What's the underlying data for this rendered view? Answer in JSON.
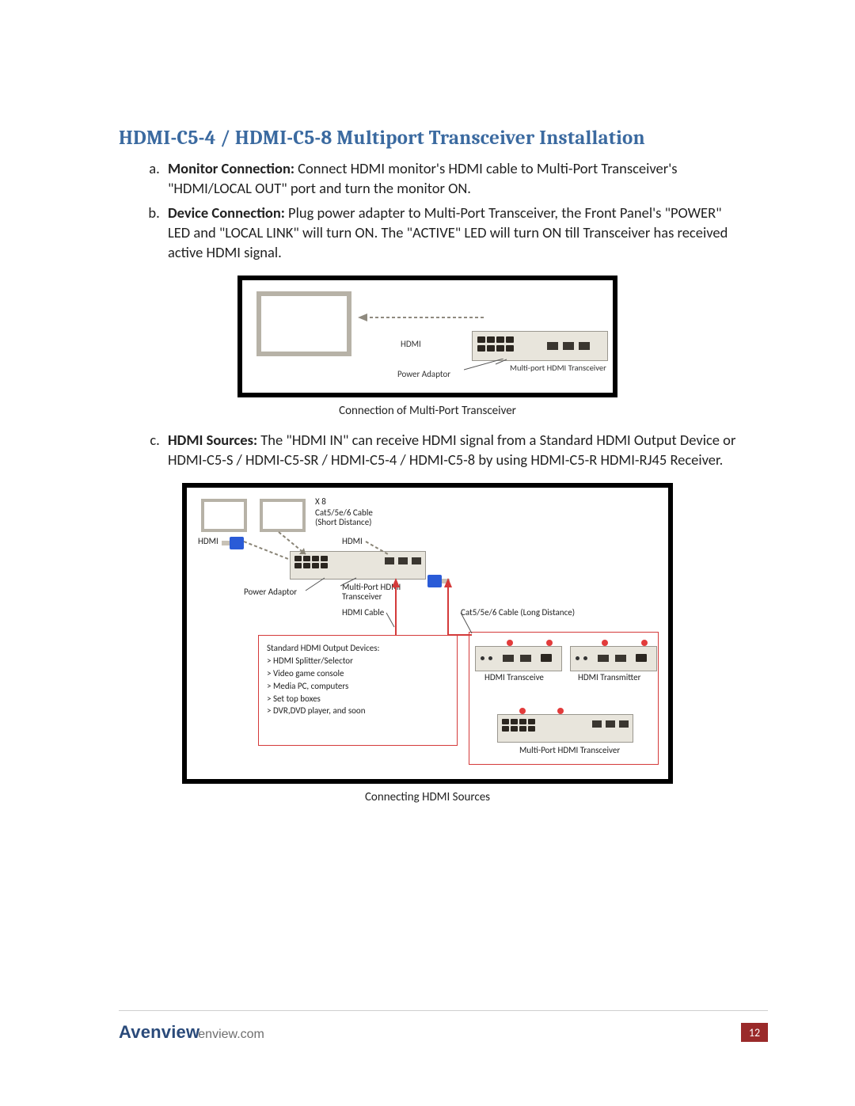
{
  "heading": "HDMI-C5-4 / HDMI-C5-8 Multiport Transceiver Installation",
  "items": {
    "a": {
      "label": "Monitor Connection:",
      "text": " Connect HDMI monitor's HDMI cable to Multi-Port Transceiver's \"HDMI/LOCAL OUT\" port and turn the monitor ON."
    },
    "b": {
      "label": "Device Connection:",
      "text": " Plug power adapter to Multi-Port Transceiver, the Front Panel's \"POWER\" LED and \"LOCAL LINK\" will turn ON. The \"ACTIVE\" LED will turn ON till Transceiver has received active HDMI signal."
    },
    "c": {
      "label": "HDMI Sources:",
      "text": " The \"HDMI IN\" can receive HDMI signal from a Standard HDMI Output Device or HDMI-C5-S / HDMI-C5-SR / HDMI-C5-4 / HDMI-C5-8 by using HDMI-C5-R HDMI-RJ45 Receiver."
    }
  },
  "fig1": {
    "hdmi": "HDMI",
    "power_adaptor": "Power Adaptor",
    "transceiver": "Multi-port HDMI Transceiver",
    "caption": "Connection of Multi-Port Transceiver"
  },
  "fig2": {
    "x8": "X 8",
    "cable_short_1": "Cat5/5e/6 Cable",
    "cable_short_2": "(Short Distance)",
    "hdmi_left": "HDMI",
    "hdmi_right": "HDMI",
    "power_adaptor": "Power Adaptor",
    "mp_trans_1": "Multi-Port HDMI",
    "mp_trans_2": "Transceiver",
    "hdmi_cable": "HDMI Cable",
    "cable_long": "Cat5/5e/6 Cable (Long Distance)",
    "std_title": "Standard HDMI Output Devices:",
    "std_1": "> HDMI Splitter/Selector",
    "std_2": "> Video game console",
    "std_3": "> Media PC, computers",
    "std_4": "> Set top boxes",
    "std_5": "> DVR,DVD player, and soon",
    "unit_transceive": "HDMI Transceive",
    "unit_transmitter": "HDMI Transmitter",
    "mp_trans_bottom": "Multi-Port HDMI Transceiver",
    "caption": "Connecting HDMI Sources"
  },
  "footer": {
    "logo_a": "Avenview",
    "logo_tail": "enview.com",
    "page": "12"
  }
}
